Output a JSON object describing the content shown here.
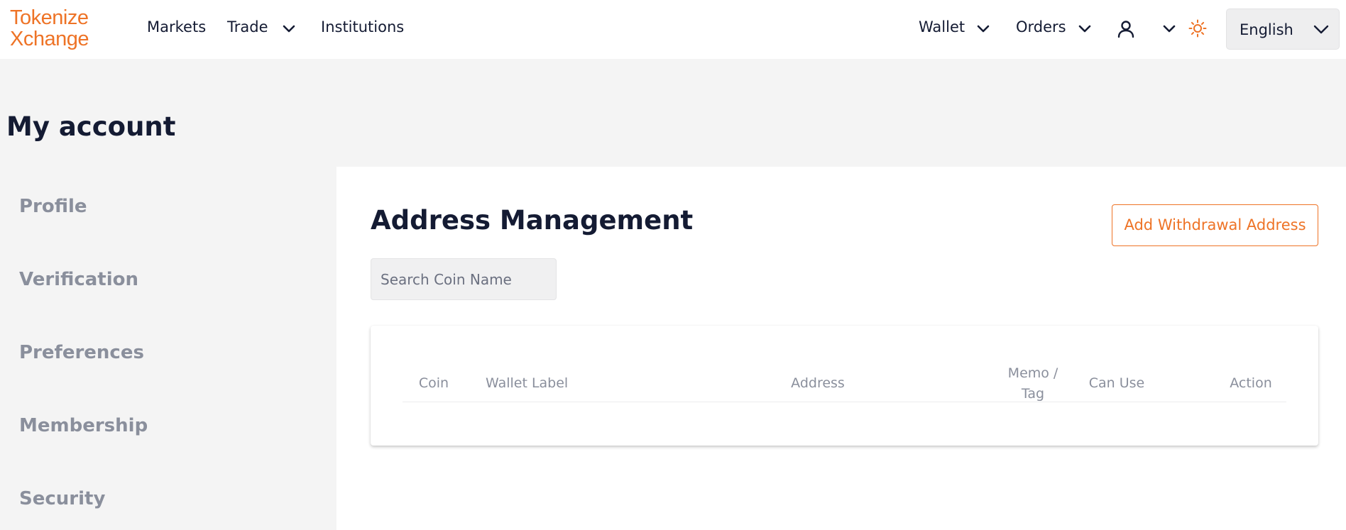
{
  "brand": {
    "logo_line1": "Tokenize",
    "logo_line2": "Xchange",
    "accent_color": "#ee7326"
  },
  "nav": {
    "markets": "Markets",
    "trade": "Trade",
    "institutions": "Institutions",
    "wallet": "Wallet",
    "orders": "Orders",
    "icons": {
      "account": "user-icon",
      "theme": "sun-icon",
      "dropdown": "chevron-down-icon"
    },
    "language": "English"
  },
  "page": {
    "title": "My account"
  },
  "sidebar": {
    "items": [
      {
        "label": "Profile"
      },
      {
        "label": "Verification"
      },
      {
        "label": "Preferences"
      },
      {
        "label": "Membership"
      },
      {
        "label": "Security"
      }
    ]
  },
  "main": {
    "title": "Address Management",
    "add_button": "Add Withdrawal Address",
    "search_placeholder": "Search Coin Name",
    "table": {
      "columns": {
        "coin": "Coin",
        "wallet_label": "Wallet Label",
        "address": "Address",
        "memo_line1": "Memo /",
        "memo_line2": "Tag",
        "can_use": "Can Use",
        "action": "Action"
      },
      "rows": []
    }
  }
}
